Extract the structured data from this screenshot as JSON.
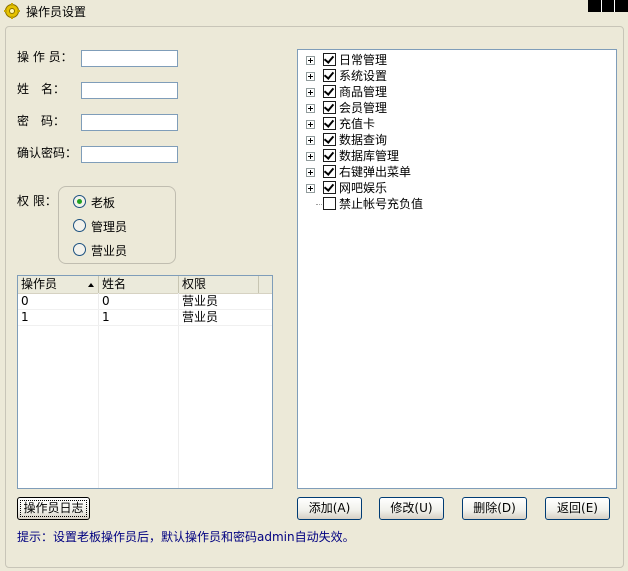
{
  "window": {
    "title": "操作员设置"
  },
  "form": {
    "operator_label": "操 作 员：",
    "name_label": "姓　名：",
    "password_label": "密　码：",
    "confirm_label": "确认密码：",
    "operator_value": "",
    "name_value": "",
    "password_value": "",
    "confirm_value": ""
  },
  "permission": {
    "label": "权 限：",
    "options": [
      {
        "label": "老板",
        "selected": true
      },
      {
        "label": "管理员",
        "selected": false
      },
      {
        "label": "营业员",
        "selected": false
      }
    ]
  },
  "table": {
    "columns": [
      "操作员",
      "姓名",
      "权限"
    ],
    "rows": [
      [
        "0",
        "0",
        "营业员"
      ],
      [
        "1",
        "1",
        "营业员"
      ]
    ]
  },
  "tree": {
    "nodes": [
      {
        "label": "日常管理",
        "checked": true,
        "expandable": true
      },
      {
        "label": "系统设置",
        "checked": true,
        "expandable": true
      },
      {
        "label": "商品管理",
        "checked": true,
        "expandable": true
      },
      {
        "label": "会员管理",
        "checked": true,
        "expandable": true
      },
      {
        "label": "充值卡",
        "checked": true,
        "expandable": true
      },
      {
        "label": "数据查询",
        "checked": true,
        "expandable": true
      },
      {
        "label": "数据库管理",
        "checked": true,
        "expandable": true
      },
      {
        "label": "右键弹出菜单",
        "checked": true,
        "expandable": true
      },
      {
        "label": "网吧娱乐",
        "checked": true,
        "expandable": true
      },
      {
        "label": "禁止帐号充负值",
        "checked": false,
        "expandable": false
      }
    ]
  },
  "buttons": {
    "log": "操作员日志",
    "add": "添加(A)",
    "modify": "修改(U)",
    "delete": "删除(D)",
    "back": "返回(E)"
  },
  "hint": "提示：设置老板操作员后，默认操作员和密码admin自动失效。",
  "colors": {
    "background": "#ece9d8",
    "hint": "#000080",
    "radio_dot": "#21a121"
  }
}
